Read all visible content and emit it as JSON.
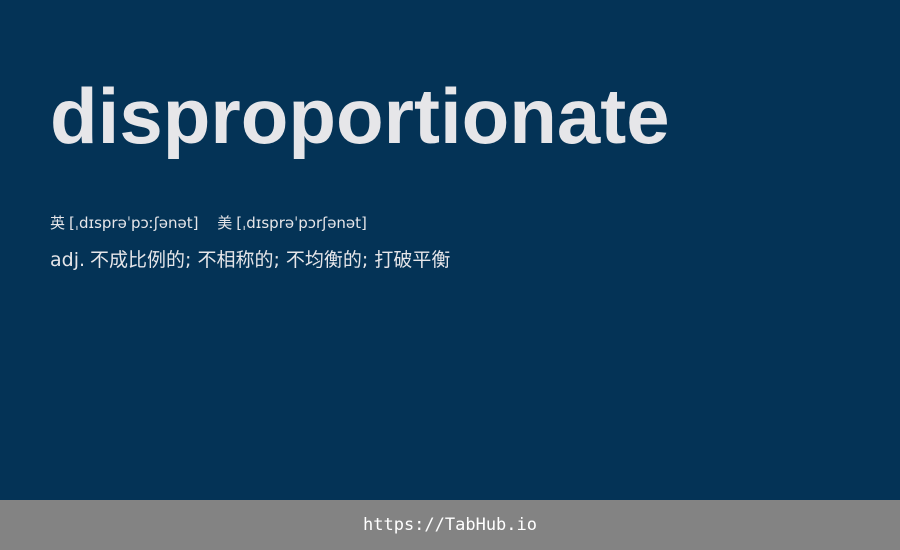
{
  "word": "disproportionate",
  "pronunciation": {
    "uk_label": "英",
    "uk_ipa": "[ˌdɪsprəˈpɔːʃənət]",
    "us_label": "美",
    "us_ipa": "[ˌdɪsprəˈpɔrʃənət]"
  },
  "definition": {
    "pos": "adj.",
    "meaning": "不成比例的; 不相称的; 不均衡的; 打破平衡"
  },
  "footer": {
    "link_text": "https://TabHub.io"
  },
  "colors": {
    "background": "#043356",
    "text": "#e6e6e9",
    "footer_bg": "#838383",
    "footer_text": "#ffffff"
  }
}
